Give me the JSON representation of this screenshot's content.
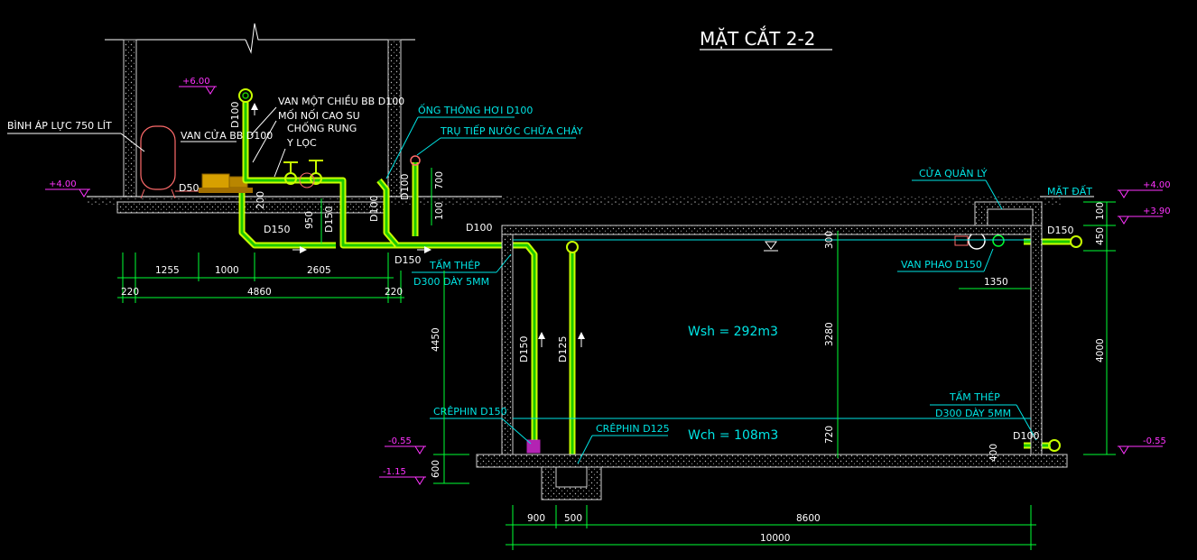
{
  "title": "MẶT CẮT 2-2",
  "labels": {
    "tank": "BÌNH ÁP LỰC 750 LÍT",
    "check_valve": "VAN MỘT CHIỀU BB D100",
    "rubber_joint_1": "MỐI NỐI CAO SU",
    "rubber_joint_2": "CHỐNG RUNG",
    "y_filter": "Y LỌC",
    "gate_valve": "VAN CỬA BB D100",
    "vent_pipe": "ỐNG THÔNG HƠI D100",
    "hydrant": "TRỤ TIẾP NƯỚC CHỮA CHÁY",
    "manhole": "CỬA QUẢN LÝ",
    "ground": "MẶT ĐẤT",
    "float_valve": "VAN PHAO D150",
    "steel_plate_1a": "TẤM THÉP",
    "steel_plate_1b": "D300 DÀY 5MM",
    "steel_plate_2a": "TẤM THÉP",
    "steel_plate_2b": "D300 DÀY 5MM",
    "strainer_150": "CRÊPHIN D150",
    "strainer_125": "CRÊPHIN D125"
  },
  "pipe_labels": {
    "d100_riser": "D100",
    "d50": "D50",
    "d150_a": "D150",
    "d150_b": "D150",
    "d150_c": "D150",
    "d100_vent": "D100",
    "d100_hydrant": "D100",
    "d100_horiz": "D100",
    "d150_float": "D150",
    "d150_suction": "D150",
    "d125_suction": "D125",
    "d100_bottom": "D100"
  },
  "volumes": {
    "wsh": "Wsh = 292m3",
    "wch": "Wch = 108m3"
  },
  "elevations": {
    "e600": "+6.00",
    "e400_left": "+4.00",
    "e400_right": "+4.00",
    "e390": "+3.90",
    "em055_left": "-0.55",
    "em055_right": "-0.55",
    "em115": "-1.15"
  },
  "dimensions": {
    "d1255": "1255",
    "d1000": "1000",
    "d2605": "2605",
    "d220_left": "220",
    "d4860": "4860",
    "d220_right": "220",
    "d200": "200",
    "d950": "950",
    "d700": "700",
    "d100_a": "100",
    "d300": "300",
    "d3280": "3280",
    "d720": "720",
    "d4450": "4450",
    "d600": "600",
    "d100_b": "100",
    "d450": "450",
    "d4000": "4000",
    "d1350": "1350",
    "d400": "400",
    "d900": "900",
    "d500": "500",
    "d8600": "8600",
    "d10000": "10000"
  },
  "colors": {
    "background": "#000000",
    "linework": "#ffffff",
    "pipe": "#c8ff00",
    "dimension": "#00ff33",
    "annotation": "#00e5e5",
    "elevation": "#ff33ff"
  }
}
